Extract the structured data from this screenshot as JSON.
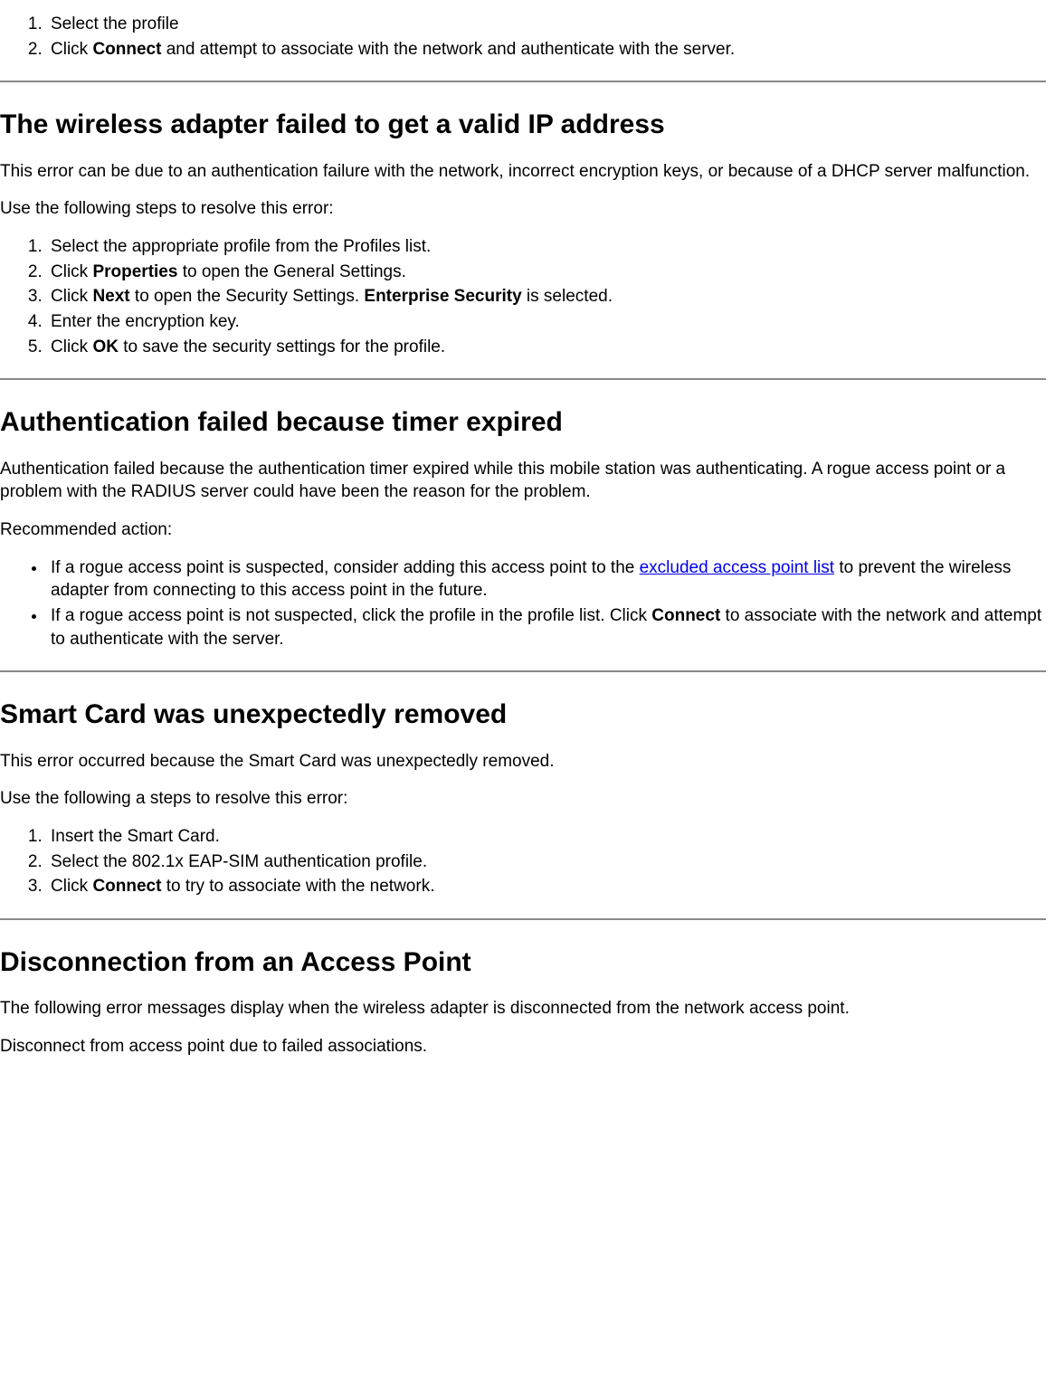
{
  "top_list": {
    "i1": "Select the profile",
    "i2_pre": "Click ",
    "i2_b": "Connect",
    "i2_post": " and attempt to associate with the network and authenticate with the server."
  },
  "sec1": {
    "heading": "The wireless adapter failed to get a valid IP address",
    "p1": "This error can be due to an authentication failure with the network, incorrect encryption keys, or because of a DHCP server malfunction.",
    "p2": "Use the following steps to resolve this error:",
    "li1": "Select the appropriate profile from the Profiles list.",
    "li2_pre": "Click ",
    "li2_b": "Properties",
    "li2_post": " to open the General Settings.",
    "li3_pre": "Click ",
    "li3_b1": "Next",
    "li3_mid": " to open the Security Settings. ",
    "li3_b2": "Enterprise Security",
    "li3_post": " is selected.",
    "li4": "Enter the encryption key.",
    "li5_pre": "Click ",
    "li5_b": "OK",
    "li5_post": " to save the security settings for the profile."
  },
  "sec2": {
    "heading": "Authentication failed because timer expired",
    "p1": "Authentication failed because the authentication timer expired while this mobile station was authenticating. A rogue access point or a problem with the RADIUS server could have been the reason for the problem.",
    "p2": "Recommended action:",
    "li1_pre": "If a rogue access point is suspected, consider adding this access point to the ",
    "li1_link": "excluded access point list",
    "li1_post": " to prevent the wireless adapter from connecting to this access point in the future.",
    "li2_pre": "If a rogue access point is not suspected, click the profile in the profile list. Click ",
    "li2_b": "Connect",
    "li2_post": " to associate with the network and attempt to authenticate with the server."
  },
  "sec3": {
    "heading": "Smart Card was unexpectedly removed",
    "p1": "This error occurred because the Smart Card was unexpectedly removed.",
    "p2": "Use the following a steps to resolve this error:",
    "li1": "Insert the Smart Card.",
    "li2": "Select the 802.1x EAP-SIM authentication profile.",
    "li3_pre": "Click ",
    "li3_b": "Connect",
    "li3_post": " to try to associate with the network."
  },
  "sec4": {
    "heading": "Disconnection from an Access Point",
    "p1": "The following error messages display when the wireless adapter is disconnected from the network access point.",
    "p2": "Disconnect from access point due to failed associations."
  }
}
